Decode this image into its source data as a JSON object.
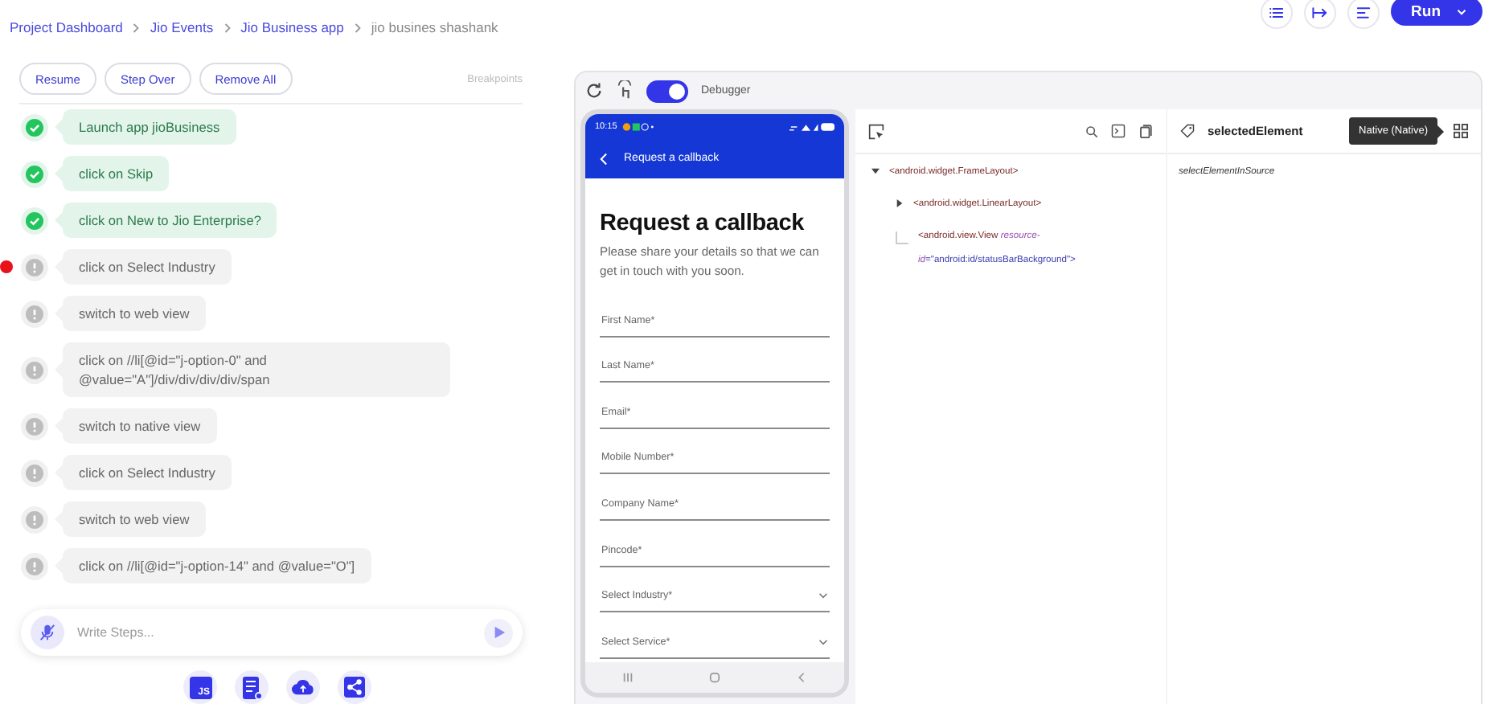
{
  "breadcrumb": [
    {
      "label": "Project Dashboard",
      "current": false
    },
    {
      "label": "Jio Events",
      "current": false
    },
    {
      "label": "Jio Business app",
      "current": false
    },
    {
      "label": "jio busines shashank",
      "current": true
    }
  ],
  "run_button": {
    "label": "Run"
  },
  "debug_controls": {
    "buttons": [
      "Resume",
      "Step Over",
      "Remove All"
    ],
    "breakpoints_label": "Breakpoints"
  },
  "steps": [
    {
      "text": "Launch app jioBusiness",
      "passed": true,
      "breakpoint": false
    },
    {
      "text": "click on Skip",
      "passed": true,
      "breakpoint": false
    },
    {
      "text": "click on New to Jio Enterprise?",
      "passed": true,
      "breakpoint": false
    },
    {
      "text": "click on Select Industry",
      "passed": false,
      "breakpoint": true
    },
    {
      "text": "switch to web view",
      "passed": false,
      "breakpoint": false
    },
    {
      "text": "click on //li[@id=\"j-option-0\" and @value=\"A\"]/div/div/div/div/span",
      "passed": false,
      "breakpoint": false
    },
    {
      "text": "switch to native view",
      "passed": false,
      "breakpoint": false
    },
    {
      "text": "click on Select Industry",
      "passed": false,
      "breakpoint": false
    },
    {
      "text": "switch to web view",
      "passed": false,
      "breakpoint": false
    },
    {
      "text": "click on //li[@id=\"j-option-14\" and @value=\"O\"]",
      "passed": false,
      "breakpoint": false
    }
  ],
  "step_input": {
    "placeholder": "Write Steps..."
  },
  "bottom_tools": [
    {
      "kind": "js",
      "label": "JS"
    },
    {
      "kind": "checklist"
    },
    {
      "kind": "cloud"
    },
    {
      "kind": "share"
    }
  ],
  "device": {
    "debugger_label": "Debugger",
    "debugger_on": true,
    "status_time": "10:15",
    "app_bar_title": "Request a callback",
    "heading": "Request a callback",
    "subtitle": "Please share your details so that we can get in touch with you soon.",
    "fields": [
      {
        "label": "First Name*",
        "kind": "text"
      },
      {
        "label": "Last Name*",
        "kind": "text"
      },
      {
        "label": "Email*",
        "kind": "text"
      },
      {
        "label": "Mobile Number*",
        "kind": "text"
      },
      {
        "label": "Company Name*",
        "kind": "text"
      },
      {
        "label": "Pincode*",
        "kind": "text"
      },
      {
        "label": "Select Industry*",
        "kind": "dropdown"
      },
      {
        "label": "Select Service*",
        "kind": "dropdown"
      }
    ]
  },
  "source_tree": [
    {
      "tag": "<android.widget.FrameLayout>",
      "expanded": true,
      "children": [
        {
          "tag": "<android.widget.LinearLayout>",
          "expanded": false
        },
        {
          "tag": "<android.view.View",
          "attribute": "resource-",
          "attribute_rest": "id",
          "value": "=\"android:id/statusBarBackground\">"
        }
      ]
    }
  ],
  "detail": {
    "title": "selectedElement",
    "hint": "selectElementInSource",
    "tooltip": "Native (Native)"
  }
}
